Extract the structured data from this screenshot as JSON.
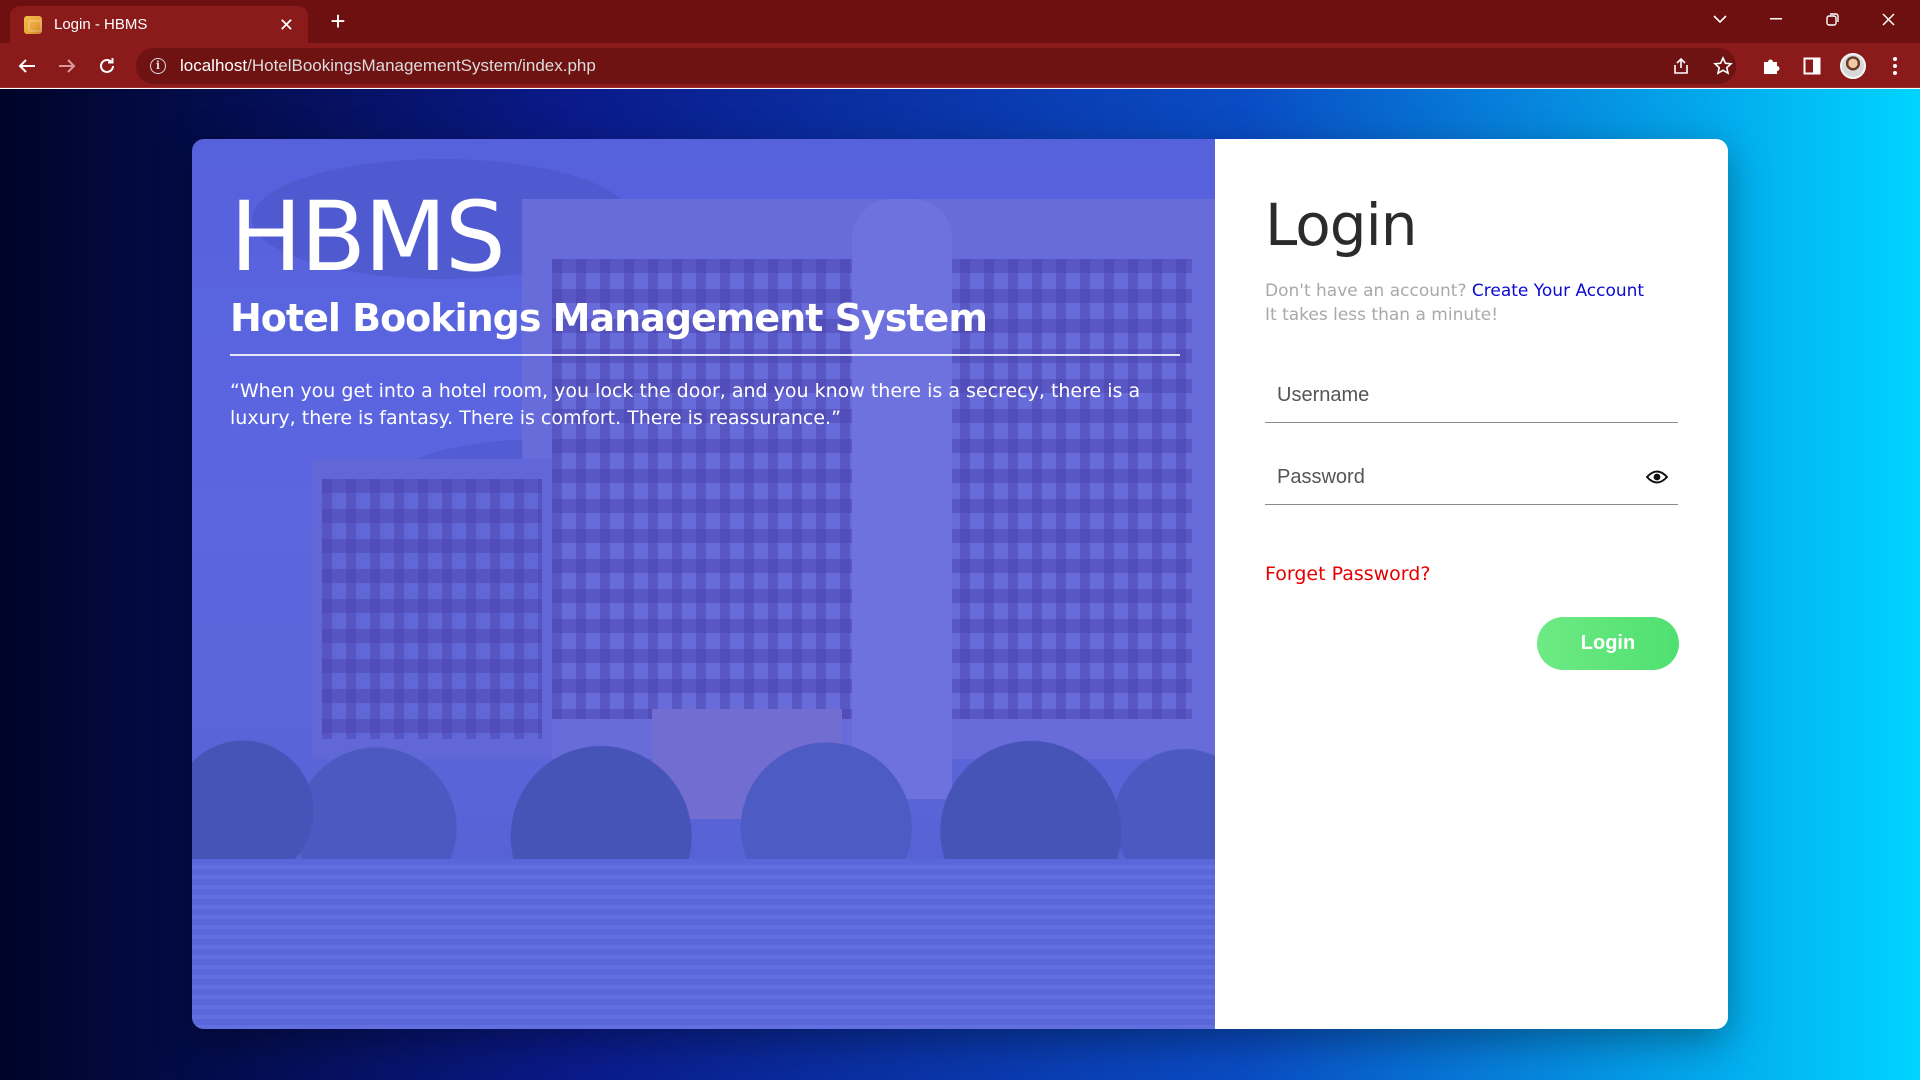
{
  "browser": {
    "tab_title": "Login - HBMS",
    "url_host": "localhost",
    "url_path": "/HotelBookingsManagementSystem/index.php"
  },
  "hero": {
    "title": "HBMS",
    "subtitle": "Hotel Bookings Management System",
    "quote": "“When you get into a hotel room, you lock the door, and you know there is a secrecy, there is a luxury, there is fantasy. There is comfort. There is reassurance.”"
  },
  "login": {
    "title": "Login",
    "no_account_text": "Don't have an account?",
    "create_account_link": "Create Your Account",
    "takes_less_text": "It takes less than a minute!",
    "username_placeholder": "Username",
    "password_placeholder": "Password",
    "forgot_password": "Forget Password?",
    "login_button": "Login"
  },
  "colors": {
    "browser_frame": "#6e1010",
    "toolbar": "#8b1a1a",
    "link_blue": "#0a0ad1",
    "forgot_red": "#e60000",
    "login_button_green": "#5ee47a"
  }
}
